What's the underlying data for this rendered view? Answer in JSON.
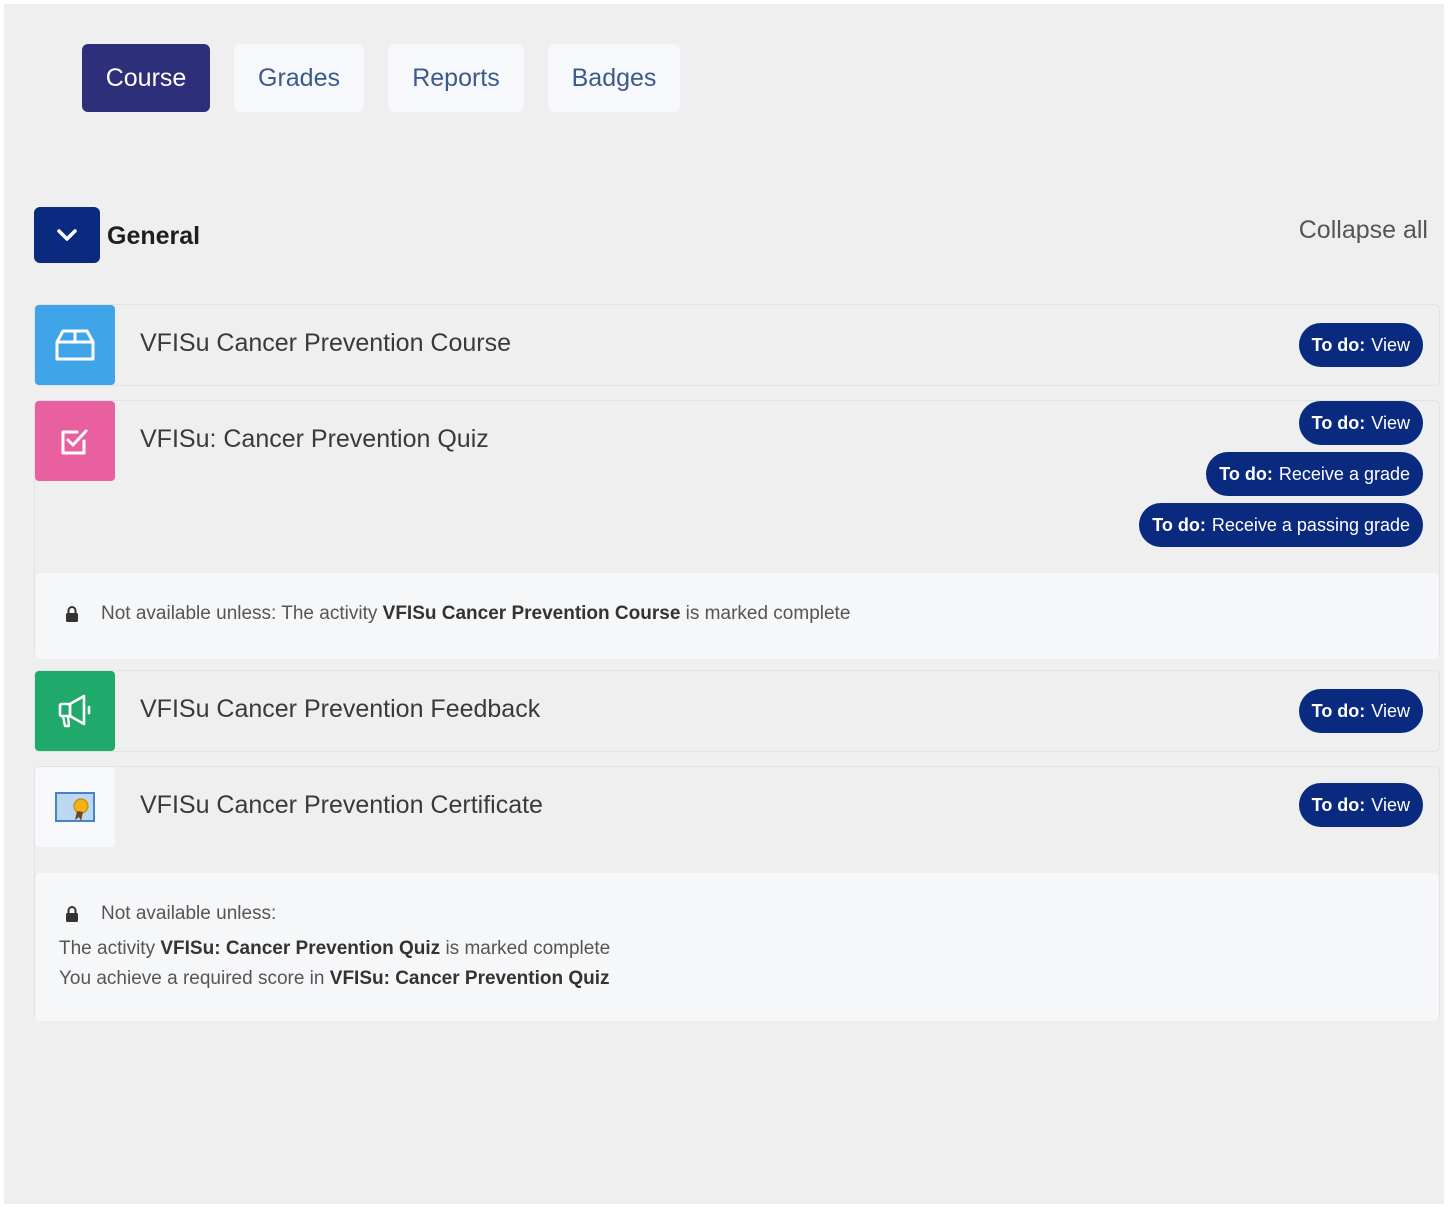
{
  "tabs": [
    {
      "label": "Course",
      "active": true
    },
    {
      "label": "Grades",
      "active": false
    },
    {
      "label": "Reports",
      "active": false
    },
    {
      "label": "Badges",
      "active": false
    }
  ],
  "section": {
    "title": "General",
    "collapse_all": "Collapse all",
    "toggle_icon": "chevron-down-icon"
  },
  "activities": [
    {
      "name": "VFISu Cancer Prevention Course",
      "icon": "package-icon",
      "icon_color": "#3fa5e8",
      "todos": [
        {
          "label": "To do:",
          "value": "View"
        }
      ]
    },
    {
      "name": "VFISu: Cancer Prevention Quiz",
      "icon": "quiz-checkbox-icon",
      "icon_color": "#e8609f",
      "todos": [
        {
          "label": "To do:",
          "value": "View"
        },
        {
          "label": "To do:",
          "value": "Receive a grade"
        },
        {
          "label": "To do:",
          "value": "Receive a passing grade"
        }
      ],
      "restriction": {
        "prefix": "Not available unless: The activity",
        "activity": "VFISu Cancer Prevention Course",
        "suffix": "is marked complete"
      }
    },
    {
      "name": "VFISu Cancer Prevention Feedback",
      "icon": "megaphone-icon",
      "icon_color": "#1fa96b",
      "todos": [
        {
          "label": "To do:",
          "value": "View"
        }
      ]
    },
    {
      "name": "VFISu Cancer Prevention Certificate",
      "icon": "certificate-icon",
      "icon_color": "#f6f8fc",
      "todos": [
        {
          "label": "To do:",
          "value": "View"
        }
      ],
      "restriction": {
        "heading": "Not available unless:",
        "line1_prefix": "The activity",
        "line1_activity": "VFISu: Cancer Prevention Quiz",
        "line1_suffix": "is marked complete",
        "line2_prefix": "You achieve a required score in",
        "line2_activity": "VFISu: Cancer Prevention Quiz"
      }
    }
  ],
  "colors": {
    "primary": "#0a2a80",
    "active_tab": "#2d2f7a",
    "background": "#efefef"
  }
}
